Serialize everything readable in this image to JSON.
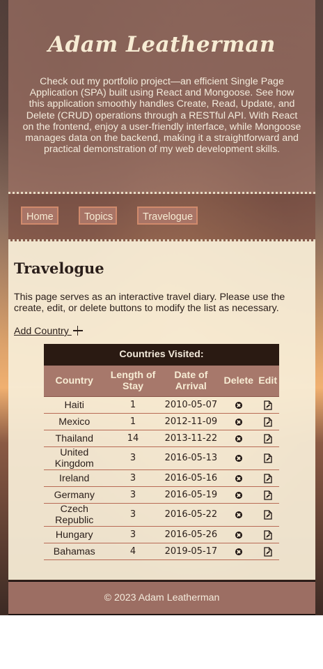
{
  "header": {
    "title": "Adam Leatherman",
    "intro": "Check out my portfolio project—an efficient Single Page Application (SPA) built using React and Mongoose. See how this application smoothly handles Create, Read, Update, and Delete (CRUD) operations through a RESTful API. With React on the frontend, enjoy a user-friendly interface, while Mongoose manages data on the backend, making it a straightforward and practical demonstration of my web development skills."
  },
  "nav": {
    "home": "Home",
    "topics": "Topics",
    "travelogue": "Travelogue"
  },
  "main": {
    "heading": "Travelogue",
    "description": "This page serves as an interactive travel diary. Please use the create, edit, or delete buttons to modify the list as necessary.",
    "add_label": "Add Country ",
    "add_icon": "plus-icon"
  },
  "table": {
    "caption": "Countries Visited:",
    "headers": {
      "country": "Country",
      "length": "Length of Stay",
      "date": "Date of Arrival",
      "delete": "Delete",
      "edit": "Edit"
    },
    "delete_icon": "close-circle-icon",
    "edit_icon": "edit-document-icon",
    "rows": [
      {
        "country": "Haiti",
        "length": "1",
        "date": "2010-05-07"
      },
      {
        "country": "Mexico",
        "length": "1",
        "date": "2012-11-09"
      },
      {
        "country": "Thailand",
        "length": "14",
        "date": "2013-11-22"
      },
      {
        "country": "United Kingdom",
        "length": "3",
        "date": "2016-05-13"
      },
      {
        "country": "Ireland",
        "length": "3",
        "date": "2016-05-16"
      },
      {
        "country": "Germany",
        "length": "3",
        "date": "2016-05-19"
      },
      {
        "country": "Czech Republic",
        "length": "3",
        "date": "2016-05-22"
      },
      {
        "country": "Hungary",
        "length": "3",
        "date": "2016-05-26"
      },
      {
        "country": "Bahamas",
        "length": "4",
        "date": "2019-05-17"
      }
    ]
  },
  "footer": {
    "text": "© 2023 Adam Leatherman"
  }
}
